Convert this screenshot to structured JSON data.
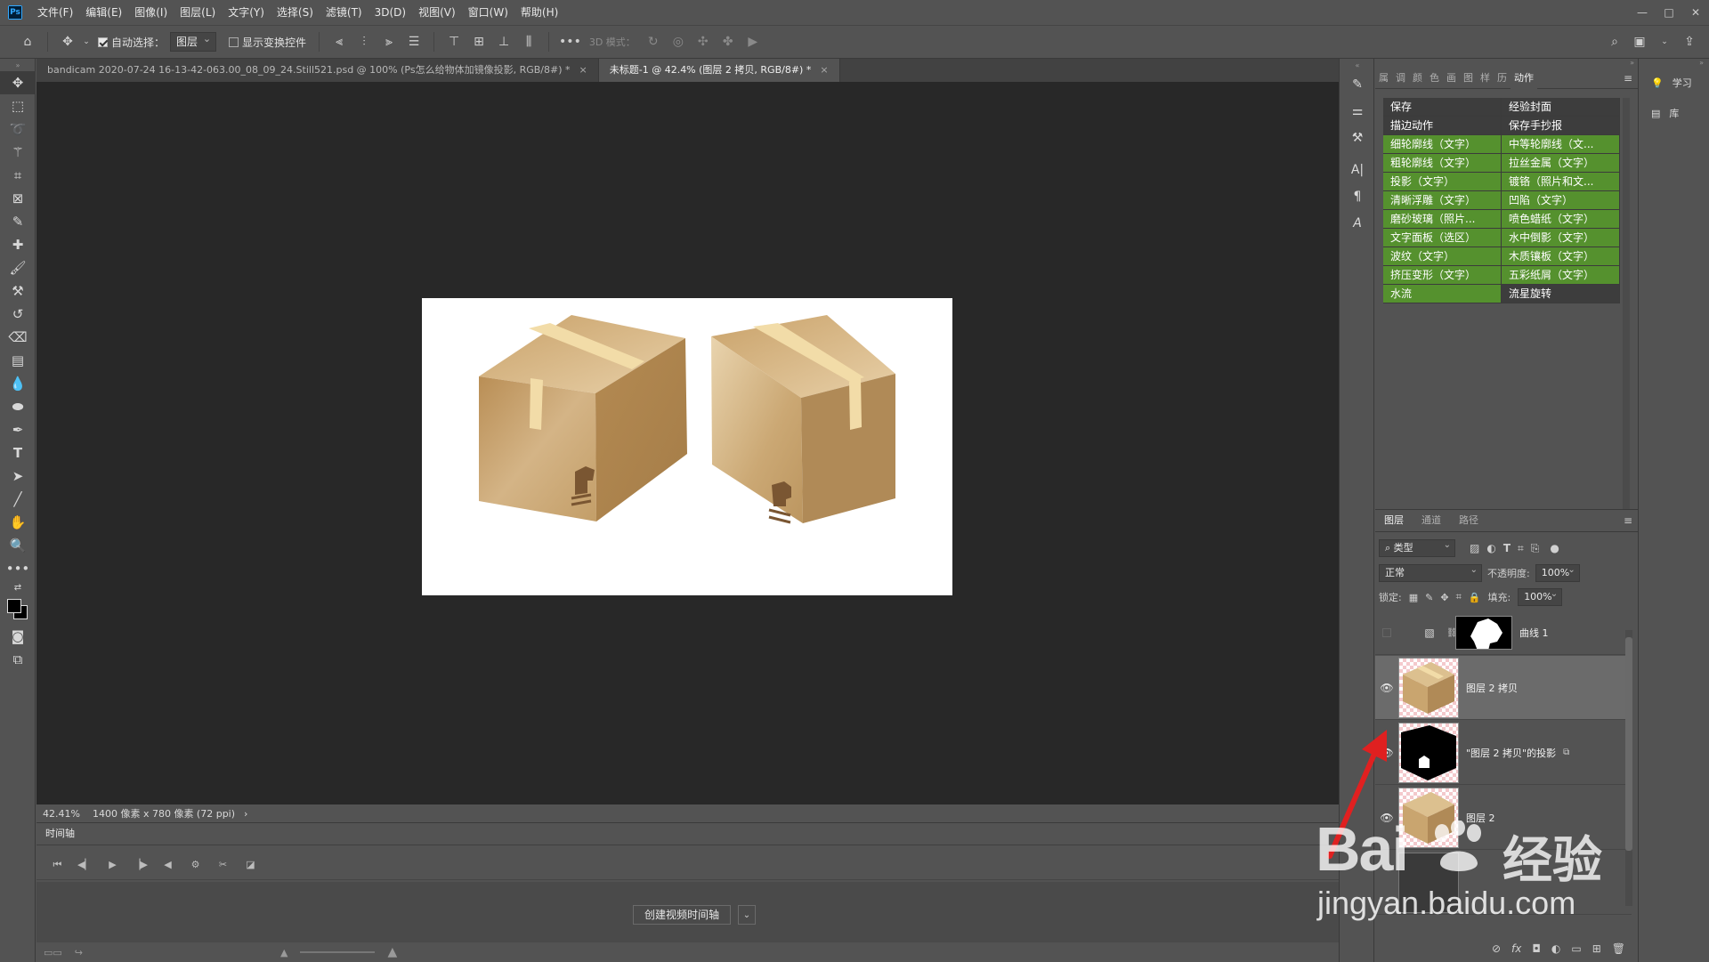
{
  "app": {
    "logo": "Ps"
  },
  "menu": [
    "文件(F)",
    "编辑(E)",
    "图像(I)",
    "图层(L)",
    "文字(Y)",
    "选择(S)",
    "滤镜(T)",
    "3D(D)",
    "视图(V)",
    "窗口(W)",
    "帮助(H)"
  ],
  "window_controls": [
    "—",
    "□",
    "✕"
  ],
  "options": {
    "auto_select_label": "自动选择：",
    "auto_select_value": "图层",
    "show_transform_label": "显示变换控件",
    "mode_3d_label": "3D 模式："
  },
  "tabs": [
    {
      "label": "bandicam 2020-07-24 16-13-42-063.00_08_09_24.Still521.psd @ 100% (Ps怎么给物体加镜像投影, RGB/8#) *",
      "close": "×"
    },
    {
      "label": "未标题-1 @ 42.4% (图层 2 拷贝, RGB/8#) *",
      "close": "×"
    }
  ],
  "status": {
    "zoom": "42.41%",
    "doc_info": "1400 像素 x 780 像素 (72 ppi)",
    "arrow": "›"
  },
  "timeline": {
    "tab_label": "时间轴",
    "create_button": "创建视频时间轴",
    "arrow": "⌄"
  },
  "panels": {
    "top_tabs": [
      "属",
      "调",
      "颜",
      "色",
      "画",
      "图",
      "样",
      "历",
      "动作"
    ],
    "actions": [
      [
        "保存",
        "经验封面"
      ],
      [
        "描边动作",
        "保存手抄报"
      ],
      [
        "细轮廓线（文字）",
        "中等轮廓线（文..."
      ],
      [
        "粗轮廓线（文字）",
        "拉丝金属（文字）"
      ],
      [
        "投影（文字）",
        "镀铬（照片和文..."
      ],
      [
        "清晰浮雕（文字）",
        "凹陷（文字）"
      ],
      [
        "磨砂玻璃（照片...",
        "喷色蜡纸（文字）"
      ],
      [
        "文字面板（选区）",
        "水中倒影（文字）"
      ],
      [
        "波纹（文字）",
        "木质镶板（文字）"
      ],
      [
        "挤压变形（文字）",
        "五彩纸屑（文字）"
      ],
      [
        "水流",
        "流星旋转"
      ]
    ],
    "action_row_colors": [
      "gray",
      "gray",
      "green",
      "green",
      "green",
      "green",
      "green",
      "green",
      "green",
      "green",
      "green"
    ],
    "layers_tabs": [
      "图层",
      "通道",
      "路径"
    ],
    "filter_label": "类型",
    "blend_mode": "正常",
    "opacity_label": "不透明度:",
    "opacity_value": "100%",
    "lock_label": "锁定:",
    "fill_label": "填充:",
    "fill_value": "100%",
    "layers": [
      {
        "name": "曲线 1"
      },
      {
        "name": "图层 2 拷贝"
      },
      {
        "name": "\"图层 2 拷贝\"的投影"
      },
      {
        "name": "图层 2"
      }
    ],
    "footer_icons": [
      "⊘",
      "fx",
      "◘",
      "◐",
      "▭",
      "⊞",
      "🗑"
    ]
  },
  "far_right": [
    {
      "label": "学习"
    },
    {
      "label": "库"
    }
  ],
  "watermark": {
    "brand": "Bai",
    "brand_cn": "经验",
    "url": "jingyan.baidu.com"
  },
  "colors": {
    "accent_green": "#55912e",
    "arrow_red": "#e02020",
    "box_tan": "#c8a46d"
  }
}
